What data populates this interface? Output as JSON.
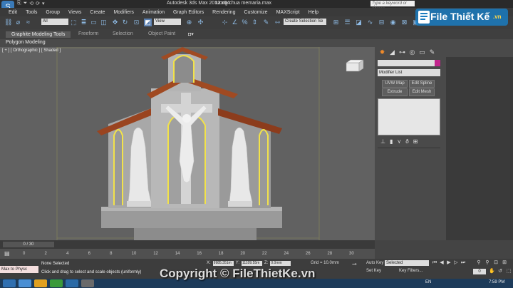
{
  "title_bar": {
    "app_title": "Autodesk 3ds Max  2012 x64",
    "file_name": "tuong chua memaria.max",
    "search_placeholder": "Type a keyword or phrase",
    "quick_access": [
      "⎘",
      "⏷",
      "⟲",
      "⟳",
      "▾"
    ]
  },
  "menu": [
    "Edit",
    "Tools",
    "Group",
    "Views",
    "Create",
    "Modifiers",
    "Animation",
    "Graph Editors",
    "Rendering",
    "Customize",
    "MAXScript",
    "Help"
  ],
  "toolbar": {
    "selection_filter": "All",
    "ref_coord": "View",
    "named_selection": "Create Selection Se"
  },
  "ribbon": {
    "tabs": [
      "Graphite Modeling Tools",
      "Freeform",
      "Selection",
      "Object Paint"
    ],
    "panel": "Polygon Modeling"
  },
  "viewport": {
    "label": "[ + ] [ Orthographic ] [ Shaded ]"
  },
  "command_panel": {
    "modifier_list": "Modifier List",
    "buttons": [
      "UVW Map",
      "Edit Spline",
      "Extrude",
      "Edit Mesh"
    ]
  },
  "timeline": {
    "frame": "0 / 30",
    "ticks": [
      "0",
      "2",
      "4",
      "6",
      "8",
      "10",
      "12",
      "14",
      "16",
      "18",
      "20",
      "22",
      "24",
      "26",
      "28",
      "30"
    ]
  },
  "status": {
    "maxscript": "Max to Physc",
    "selection": "None Selected",
    "prompt": "Click and drag to select and scale objects (uniformly)",
    "x_label": "X:",
    "x_value": "9985.351m",
    "y_label": "Y:",
    "y_value": "11109.55m",
    "z_label": "Z:",
    "z_value": "0.0mm",
    "grid": "Grid = 10.0mm",
    "auto_key": "Auto Key",
    "set_key": "Set Key",
    "selected_dd": "Selected",
    "key_filters": "Key Filters...",
    "current_frame": "0"
  },
  "taskbar": {
    "language": "EN",
    "time": "7:59 PM"
  },
  "watermark": {
    "logo_text": "File Thiết Kế",
    "logo_suffix": ".vn",
    "bottom_text": "Copyright © FileThietKe.vn"
  },
  "colors": {
    "accent": "#8fbce6",
    "wire_yellow": "#f2e24a",
    "roof": "#a04a22",
    "swatch": "#c2248c"
  }
}
